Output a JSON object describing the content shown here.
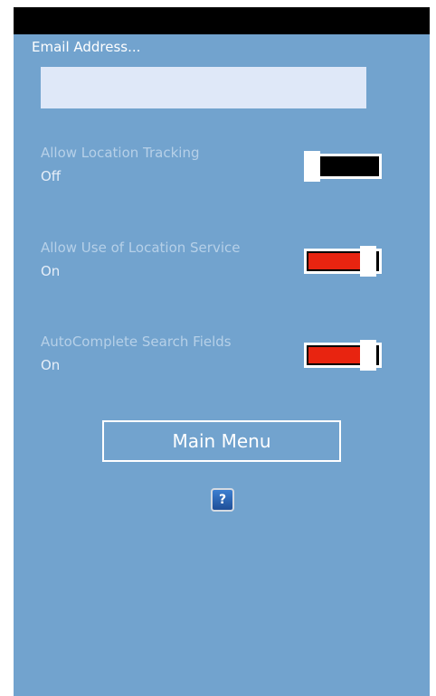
{
  "email": {
    "label": "Email Address...",
    "value": "",
    "placeholder": ""
  },
  "settings": [
    {
      "title": "Allow Location Tracking",
      "state": "Off",
      "enabled": false
    },
    {
      "title": "Allow Use of Location Service",
      "state": "On",
      "enabled": true
    },
    {
      "title": "AutoComplete Search Fields",
      "state": "On",
      "enabled": true
    }
  ],
  "main_menu_label": "Main Menu",
  "help": {
    "glyph": "?",
    "icon": "help-icon"
  },
  "colors": {
    "background": "#72a3ce",
    "toggle_on": "#e82410",
    "toggle_off": "#000000",
    "input_bg": "#dfe8f8"
  }
}
